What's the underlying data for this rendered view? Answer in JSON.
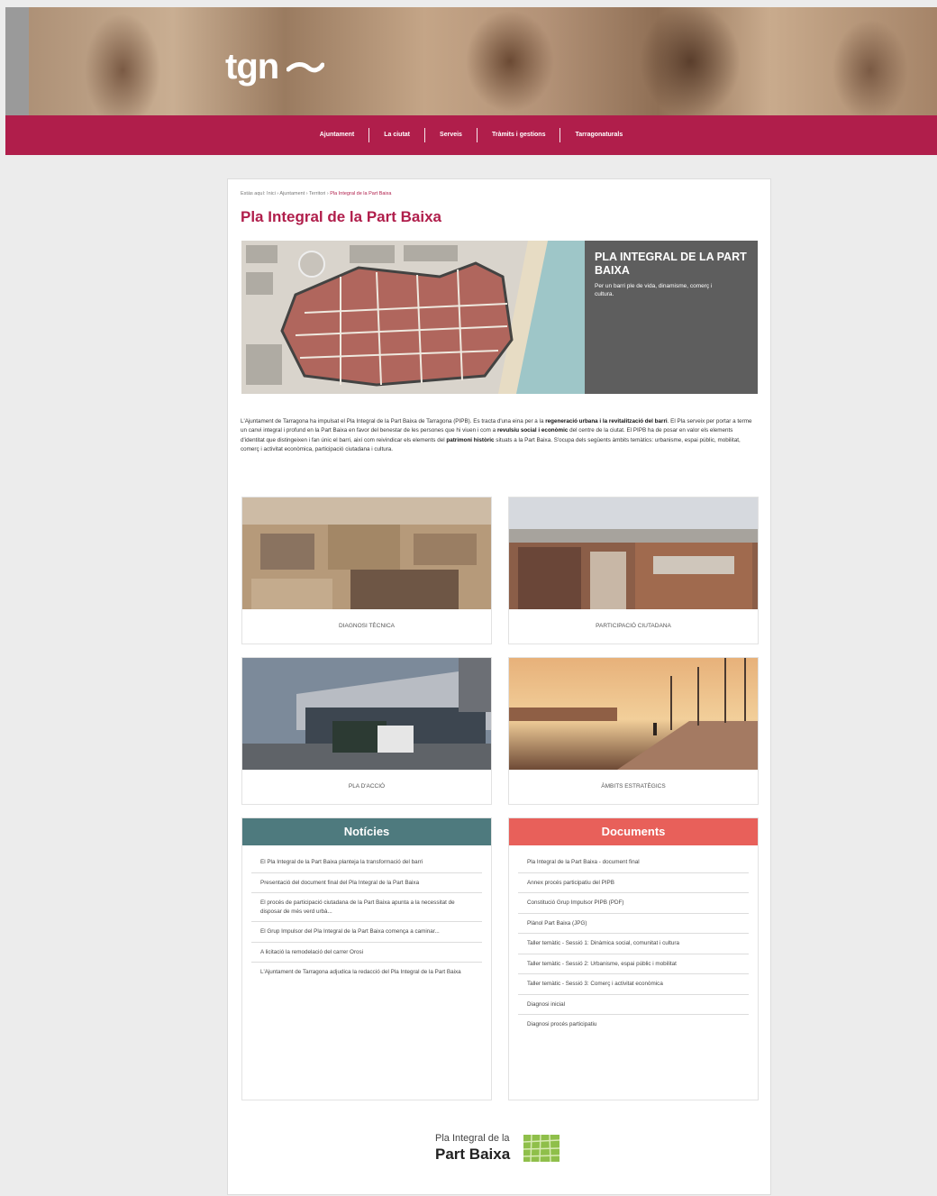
{
  "header": {
    "logo_text": "tgn",
    "nav": [
      "Ajuntament",
      "La ciutat",
      "Serveis",
      "Tràmits i gestions",
      "Tarragonaturals"
    ]
  },
  "breadcrumb": {
    "prefix": "Estàs aquí: Inici",
    "items": [
      "Ajuntament",
      "Territori"
    ],
    "current": "Pla Integral de la Part Baixa"
  },
  "page_title": "Pla Integral de la Part Baixa",
  "banner": {
    "title": "PLA INTEGRAL DE LA PART BAIXA",
    "subtitle": "Per un barri ple de vida, dinamisme, comerç i cultura."
  },
  "intro": {
    "p1": "L'Ajuntament de Tarragona ha impulsat el Pla Integral de la Part Baixa de Tarragona (PIPB). Es tracta d'una eina per a la ",
    "b1": "regeneració urbana i la revitalització del barri",
    "p2": ". El Pla serveix per portar a terme un canvi integral i profund en la Part Baixa en favor del benestar de les persones que hi viuen i com a ",
    "b2": "revulsiu social i econòmic",
    "p3": " del centre de la ciutat. El PIPB ha de posar en valor els elements d'identitat que distingeixen i fan únic el barri, així com reivindicar els elements del ",
    "b3": "patrimoni històric",
    "p4": " situats a la Part Baixa. S'ocupa dels següents àmbits temàtics: urbanisme, espai públic, mobilitat, comerç i activitat econòmica, participació ciutadana i cultura."
  },
  "tiles": [
    {
      "label": "DIAGNOSI TÈCNICA"
    },
    {
      "label": "PARTICIPACIÓ CIUTADANA"
    },
    {
      "label": "PLA D'ACCIÓ"
    },
    {
      "label": "ÀMBITS ESTRATÈGICS"
    }
  ],
  "news": {
    "heading": "Notícies",
    "color": "#4e7a7e",
    "items": [
      "El Pla Integral de la Part Baixa planteja la transformació del barri",
      "Presentació del document final del Pla Integral de la Part Baixa",
      "El procés de participació ciutadana de la Part Baixa apunta a la necessitat de disposar de més verd urbà...",
      "El Grup Impulsor del Pla Integral de la Part Baixa comença a caminar...",
      "A licitació la remodelació del carrer Orosi",
      "L'Ajuntament de Tarragona adjudica la redacció del Pla Integral de la Part Baixa"
    ]
  },
  "documents": {
    "heading": "Documents",
    "color": "#e8605a",
    "items": [
      "Pla Integral de la Part Baixa - document final",
      "Annex procés participatiu del PIPB",
      "Constitució Grup Impulsor PIPB (PDF)",
      "Plànol Part Baixa (JPG)",
      "Taller temàtic - Sessió 1: Dinàmica social, comunitat i cultura",
      "Taller temàtic - Sessió 2: Urbanisme, espai públic i mobilitat",
      "Taller temàtic - Sessió 3: Comerç i activitat econòmica",
      "Diagnosi inicial",
      "Diagnosi procés participatiu"
    ]
  },
  "footer_logo": {
    "line1": "Pla Integral de la",
    "line2": "Part Baixa"
  }
}
